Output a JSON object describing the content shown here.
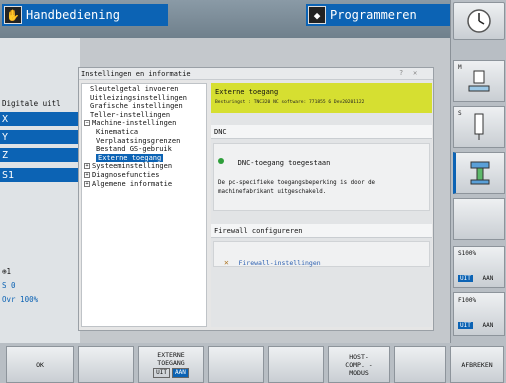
{
  "header": {
    "mode_left": "Handbediening",
    "mode_right": "Programmeren"
  },
  "left_panel": {
    "tab_label": "Digitale uitl",
    "axes": [
      "X",
      "Y",
      "Z"
    ],
    "s_label": "S1",
    "bottom_lines": [
      "⊕1",
      "S 0",
      "Ovr 100%"
    ]
  },
  "dialog": {
    "title": "Instellingen en informatie",
    "tree": [
      {
        "label": "Sleutelgetal invoeren",
        "indent": 1,
        "exp": ""
      },
      {
        "label": "Uitleizingsinstellingen",
        "indent": 1,
        "exp": ""
      },
      {
        "label": "Grafische instellingen",
        "indent": 1,
        "exp": ""
      },
      {
        "label": "Teller-instellingen",
        "indent": 1,
        "exp": ""
      },
      {
        "label": "Machine-instellingen",
        "indent": 0,
        "exp": "−"
      },
      {
        "label": "Kinematica",
        "indent": 2,
        "exp": ""
      },
      {
        "label": "Verplaatsingsgrenzen",
        "indent": 2,
        "exp": ""
      },
      {
        "label": "Bestand GS-gebruik",
        "indent": 2,
        "exp": ""
      },
      {
        "label": "Externe toegang",
        "indent": 2,
        "exp": "",
        "selected": true
      },
      {
        "label": "Systeeminstellingen",
        "indent": 0,
        "exp": "+"
      },
      {
        "label": "Diagnosefuncties",
        "indent": 0,
        "exp": "+"
      },
      {
        "label": "Algemene informatie",
        "indent": 0,
        "exp": "+"
      }
    ],
    "banner_title": "Externe toegang",
    "banner_sub": "Besturingst : TNC320      NC software: 771855 6 Dev20201122",
    "dnc_header": "DNC",
    "dnc_status": "DNC-toegang toegestaan",
    "dnc_info": "De pc-specifieke toegangsbeperking is door de machinefabrikant uitgeschakeld.",
    "firewall_header": "Firewall configureren",
    "firewall_link": "Firewall-instellingen"
  },
  "bottom_keys": {
    "ok": "OK",
    "externe_line1": "EXTERNE",
    "externe_line2": "TOEGANG",
    "uit": "UIT",
    "aan": "AAN",
    "host_line1": "HOST-",
    "host_line2": "COMP. -",
    "host_line3": "MODUS",
    "afbreken": "AFBREKEN"
  },
  "right_keys": {
    "m_label": "M",
    "s_label": "S",
    "s100": "S100%",
    "f100": "F100%",
    "uit": "UIT",
    "aan": "AAN"
  },
  "colors": {
    "accent_blue": "#0c63b4",
    "banner_yellow": "#d6df31",
    "status_green": "#2e9e3a"
  }
}
